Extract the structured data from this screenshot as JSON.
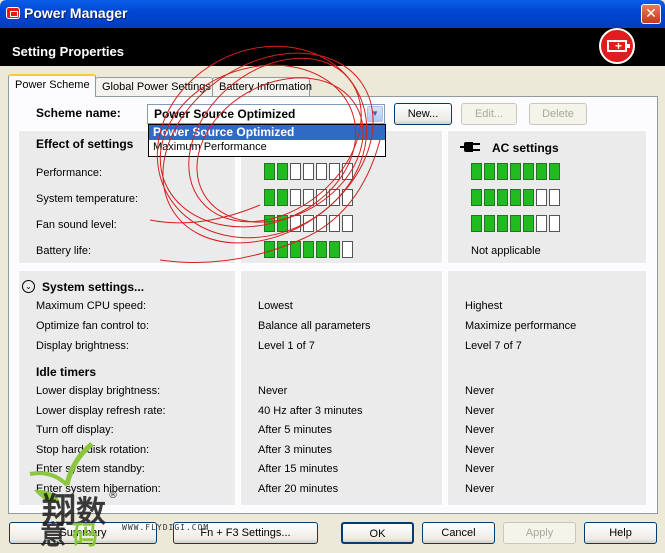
{
  "window": {
    "title": "Power Manager",
    "close_glyph": "✕"
  },
  "header": {
    "title": "Setting Properties",
    "logo_icon": "battery-plus-icon"
  },
  "tabs": [
    {
      "label": "Power Scheme",
      "active": true
    },
    {
      "label": "Global Power Settings",
      "active": false
    },
    {
      "label": "Battery Information",
      "active": false
    }
  ],
  "scheme": {
    "label": "Scheme name:",
    "value": "Power Source Optimized",
    "options": [
      "Power Source Optimized",
      "Maximum Performance"
    ],
    "new_button": "New...",
    "edit_button": "Edit...",
    "delete_button": "Delete"
  },
  "effect": {
    "heading": "Effect of settings",
    "ac_heading": "AC settings",
    "rows": [
      {
        "label": "Performance:",
        "battery_level": 2,
        "ac_level": 7
      },
      {
        "label": "System temperature:",
        "battery_level": 2,
        "ac_level": 5
      },
      {
        "label": "Fan sound level:",
        "battery_level": 2,
        "ac_level": 5
      },
      {
        "label": "Battery life:",
        "battery_level": 6,
        "ac_text": "Not applicable"
      }
    ],
    "bar_total": 7
  },
  "system": {
    "heading": "System settings...",
    "rows": [
      {
        "label": "Maximum CPU speed:",
        "battery": "Lowest",
        "ac": "Highest"
      },
      {
        "label": "Optimize fan control to:",
        "battery": "Balance all parameters",
        "ac": "Maximize performance"
      },
      {
        "label": "Display brightness:",
        "battery": "Level 1 of 7",
        "ac": "Level 7 of 7"
      }
    ],
    "idle_heading": "Idle timers",
    "idle_rows": [
      {
        "label": "Lower display brightness:",
        "battery": "Never",
        "ac": "Never"
      },
      {
        "label": "Lower display refresh rate:",
        "battery": "40 Hz after 3 minutes",
        "ac": "Never"
      },
      {
        "label": "Turn off display:",
        "battery": "After 5 minutes",
        "ac": "Never"
      },
      {
        "label": "Stop hard disk rotation:",
        "battery": "After 3 minutes",
        "ac": "Never"
      },
      {
        "label": "Enter system standby:",
        "battery": "After 15 minutes",
        "ac": "Never"
      },
      {
        "label": "Enter system hibernation:",
        "battery": "After 20 minutes",
        "ac": "Never"
      }
    ]
  },
  "footer": {
    "left_button": "Summary",
    "fn_button": "Fn + F3 Settings...",
    "ok": "OK",
    "cancel": "Cancel",
    "apply": "Apply",
    "help": "Help"
  },
  "watermark": {
    "url": "WWW.FLYDIGI.COM"
  },
  "colors": {
    "bar_on": "#1fbb1f",
    "titlebar": "#0047d3",
    "selection": "#316ac5"
  }
}
